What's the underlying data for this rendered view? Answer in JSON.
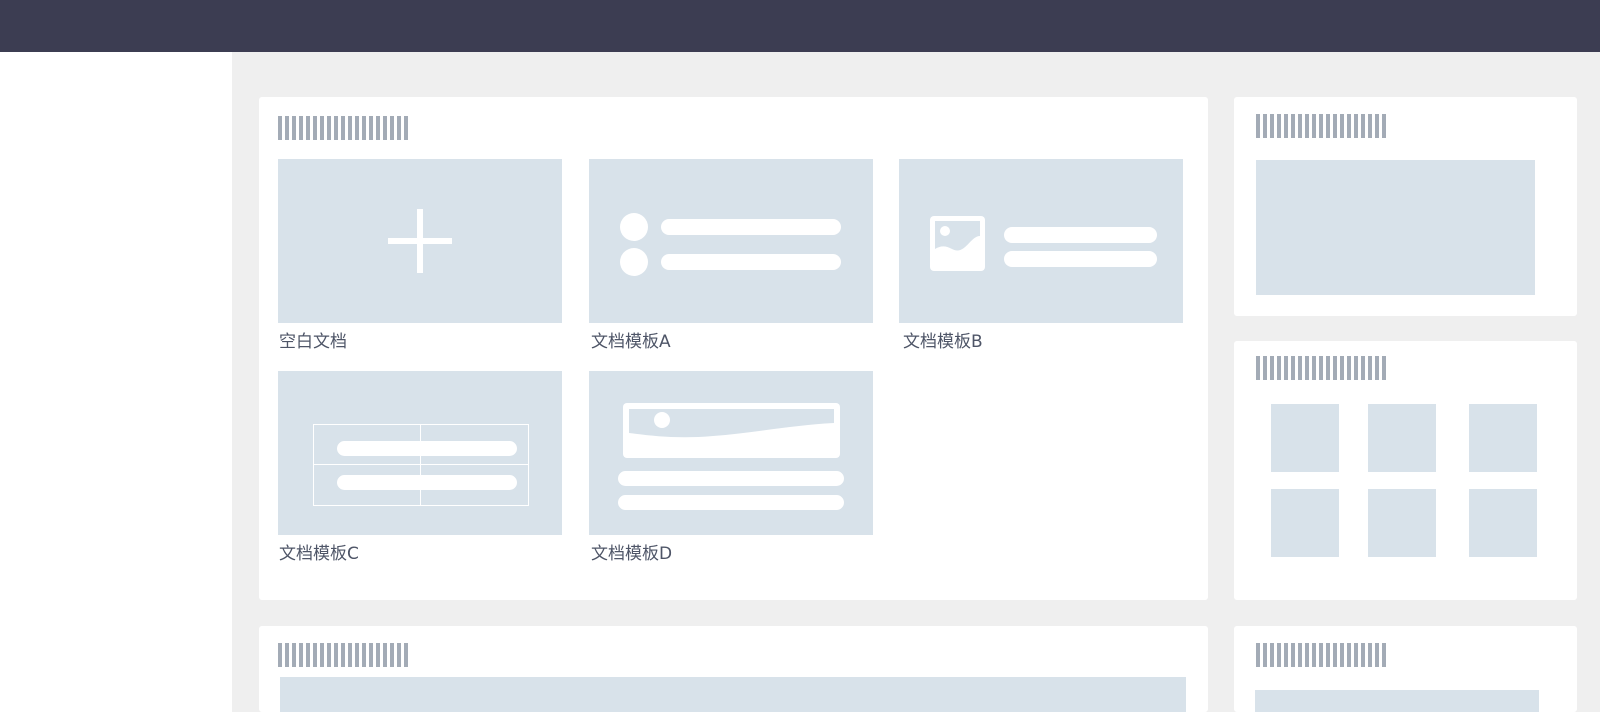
{
  "templates": [
    {
      "label": "空白文档",
      "icon": "plus-icon"
    },
    {
      "label": "文档模板A",
      "icon": "list-icon"
    },
    {
      "label": "文档模板B",
      "icon": "image-text-icon"
    },
    {
      "label": "文档模板C",
      "icon": "table-icon"
    },
    {
      "label": "文档模板D",
      "icon": "banner-icon"
    }
  ],
  "colors": {
    "topbar": "#3c3d52",
    "placeholder": "#d8e2ea",
    "page_bg": "#efefef",
    "title_bars": "#a3abb6",
    "label_text": "#4e5567"
  }
}
